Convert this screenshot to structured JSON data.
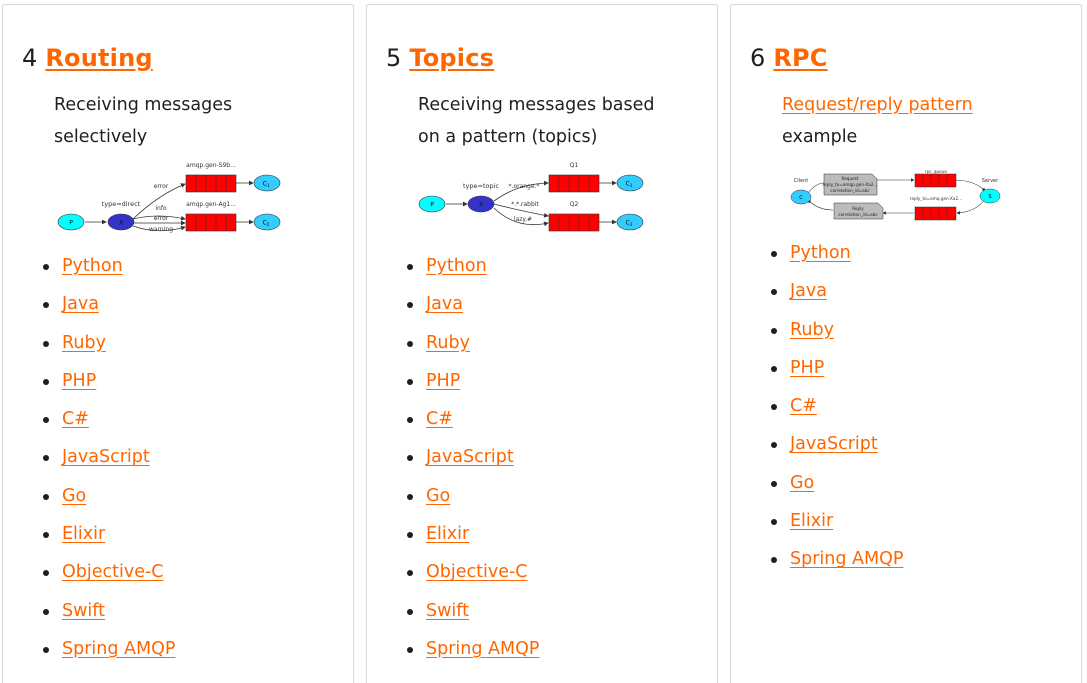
{
  "cards": [
    {
      "number": "4",
      "title": "Routing",
      "description": "Receiving messages selectively",
      "diagram": {
        "producer": "P",
        "exchange": "X",
        "exchange_type": "type=direct",
        "queue1": "amqp.gen-S9b...",
        "queue2": "amqp.gen-Ag1...",
        "binding1": "error",
        "binding2": "info",
        "binding3": "error",
        "binding4": "warning",
        "consumer1": "C",
        "consumer1_sub": "1",
        "consumer2": "C",
        "consumer2_sub": "2"
      },
      "links": [
        "Python",
        "Java",
        "Ruby",
        "PHP",
        "C#",
        "JavaScript",
        "Go",
        "Elixir",
        "Objective-C",
        "Swift",
        "Spring AMQP"
      ]
    },
    {
      "number": "5",
      "title": "Topics",
      "description": "Receiving messages based on a pattern (topics)",
      "diagram": {
        "producer": "P",
        "exchange": "X",
        "exchange_type": "type=topic",
        "queue1": "Q1",
        "queue2": "Q2",
        "binding1": "*.orange.*",
        "binding2": "*.*.rabbit",
        "binding3": "lazy.#",
        "consumer1": "C",
        "consumer1_sub": "1",
        "consumer2": "C",
        "consumer2_sub": "2"
      },
      "links": [
        "Python",
        "Java",
        "Ruby",
        "PHP",
        "C#",
        "JavaScript",
        "Go",
        "Elixir",
        "Objective-C",
        "Swift",
        "Spring AMQP"
      ]
    },
    {
      "number": "6",
      "title": "RPC",
      "description_link": "Request/reply pattern",
      "description_rest": "example",
      "diagram": {
        "client_label": "Client",
        "server_label": "Server",
        "client": "C",
        "server": "S",
        "request_queue": "rpc_queue",
        "reply_queue": "reply_to=amq.gen-Xa2...",
        "request_line1": "Request",
        "request_line2": "reply_to=amqp.gen-Xa2...",
        "request_line3": "correlation_id=abc",
        "reply_line1": "Reply",
        "reply_line2": "correlation_id=abc"
      },
      "links": [
        "Python",
        "Java",
        "Ruby",
        "PHP",
        "C#",
        "JavaScript",
        "Go",
        "Elixir",
        "Spring AMQP"
      ]
    }
  ],
  "colors": {
    "link": "#ff6600",
    "queue": "#ff0000",
    "producer": "#00ffff",
    "exchange": "#3333cc",
    "consumer": "#33ccff"
  }
}
